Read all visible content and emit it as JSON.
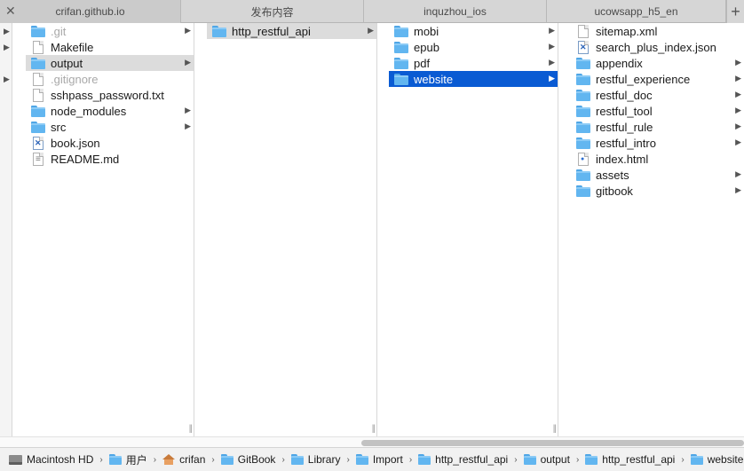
{
  "tabs": [
    {
      "label": "crifan.github.io"
    },
    {
      "label": "发布内容"
    },
    {
      "label": "inquzhou_ios"
    },
    {
      "label": "ucowsapp_h5_en"
    }
  ],
  "tab_add_label": "+",
  "tab_close_label": "✕",
  "columns": {
    "col1": [
      {
        "name": ".git",
        "kind": "folder",
        "dim": true,
        "arrow": true
      },
      {
        "name": "Makefile",
        "kind": "file"
      },
      {
        "name": "output",
        "kind": "folder",
        "arrow": true,
        "selected": "gray"
      },
      {
        "name": ".gitignore",
        "kind": "file",
        "dim": true
      },
      {
        "name": "sshpass_password.txt",
        "kind": "file"
      },
      {
        "name": "node_modules",
        "kind": "folder",
        "arrow": true
      },
      {
        "name": "src",
        "kind": "folder",
        "arrow": true
      },
      {
        "name": "book.json",
        "kind": "vs"
      },
      {
        "name": "README.md",
        "kind": "md"
      }
    ],
    "col2": [
      {
        "name": "http_restful_api",
        "kind": "folder",
        "arrow": true,
        "selected": "gray"
      }
    ],
    "col3": [
      {
        "name": "mobi",
        "kind": "folder",
        "arrow": true
      },
      {
        "name": "epub",
        "kind": "folder",
        "arrow": true
      },
      {
        "name": "pdf",
        "kind": "folder",
        "arrow": true
      },
      {
        "name": "website",
        "kind": "folder",
        "arrow": true,
        "selected": "blue"
      }
    ],
    "col4": [
      {
        "name": "sitemap.xml",
        "kind": "file"
      },
      {
        "name": "search_plus_index.json",
        "kind": "vs"
      },
      {
        "name": "appendix",
        "kind": "folder",
        "arrow": true
      },
      {
        "name": "restful_experience",
        "kind": "folder",
        "arrow": true
      },
      {
        "name": "restful_doc",
        "kind": "folder",
        "arrow": true
      },
      {
        "name": "restful_tool",
        "kind": "folder",
        "arrow": true
      },
      {
        "name": "restful_rule",
        "kind": "folder",
        "arrow": true
      },
      {
        "name": "restful_intro",
        "kind": "folder",
        "arrow": true
      },
      {
        "name": "index.html",
        "kind": "html"
      },
      {
        "name": "assets",
        "kind": "folder",
        "arrow": true
      },
      {
        "name": "gitbook",
        "kind": "folder",
        "arrow": true
      }
    ]
  },
  "path": [
    {
      "label": "Macintosh HD",
      "icon": "hd-icon"
    },
    {
      "label": "用户",
      "icon": "folder-icon"
    },
    {
      "label": "crifan",
      "icon": "home-icon"
    },
    {
      "label": "GitBook",
      "icon": "folder-icon"
    },
    {
      "label": "Library",
      "icon": "folder-icon"
    },
    {
      "label": "Import",
      "icon": "folder-icon"
    },
    {
      "label": "http_restful_api",
      "icon": "folder-icon"
    },
    {
      "label": "output",
      "icon": "folder-icon"
    },
    {
      "label": "http_restful_api",
      "icon": "folder-icon"
    },
    {
      "label": "website",
      "icon": "folder-icon"
    }
  ],
  "colors": {
    "selection_blue": "#0a5bd3",
    "selection_gray": "#dcdcdc",
    "folder": "#62b6f0"
  }
}
